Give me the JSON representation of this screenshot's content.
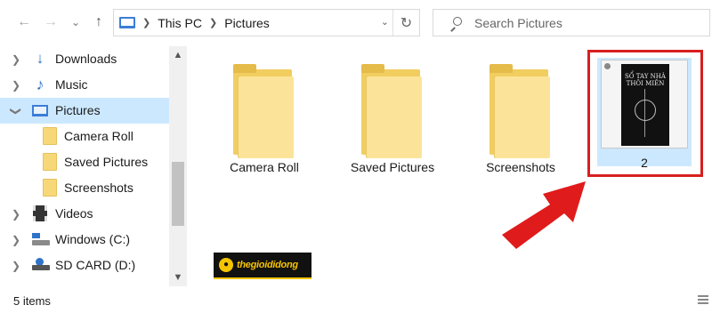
{
  "navigation": {
    "back_icon": "arrow-left-icon",
    "forward_icon": "arrow-right-icon",
    "recent_icon": "chevron-down-icon",
    "up_icon": "arrow-up-icon"
  },
  "address": {
    "crumbs": [
      "This PC",
      "Pictures"
    ],
    "refresh_icon": "refresh-icon"
  },
  "search": {
    "placeholder": "Search Pictures"
  },
  "sidebar": {
    "items": [
      {
        "label": "Downloads",
        "icon": "download-icon",
        "expandable": true
      },
      {
        "label": "Music",
        "icon": "music-icon",
        "expandable": true
      },
      {
        "label": "Pictures",
        "icon": "pictures-icon",
        "expandable": true,
        "expanded": true,
        "selected": true
      },
      {
        "label": "Camera Roll",
        "icon": "folder-icon"
      },
      {
        "label": "Saved Pictures",
        "icon": "folder-icon"
      },
      {
        "label": "Screenshots",
        "icon": "folder-icon"
      },
      {
        "label": "Videos",
        "icon": "videos-icon",
        "expandable": true
      },
      {
        "label": "Windows (C:)",
        "icon": "drive-icon",
        "expandable": true
      },
      {
        "label": "SD CARD (D:)",
        "icon": "sd-card-icon",
        "expandable": true
      }
    ]
  },
  "content": {
    "folders": [
      {
        "label": "Camera Roll"
      },
      {
        "label": "Saved Pictures"
      },
      {
        "label": "Screenshots"
      }
    ],
    "files": [
      {
        "label": "2",
        "cover_title": "SỔ TAY NHÀ THÔI MIÊN",
        "selected": true
      }
    ]
  },
  "watermark": {
    "text": "thegioididong"
  },
  "status": {
    "item_count": "5 items"
  },
  "colors": {
    "selection": "#cce8ff",
    "highlight_border": "#d81f1f",
    "arrow": "#e01b1b",
    "folder": "#f2cd5f",
    "accent": "#2f73c9"
  }
}
